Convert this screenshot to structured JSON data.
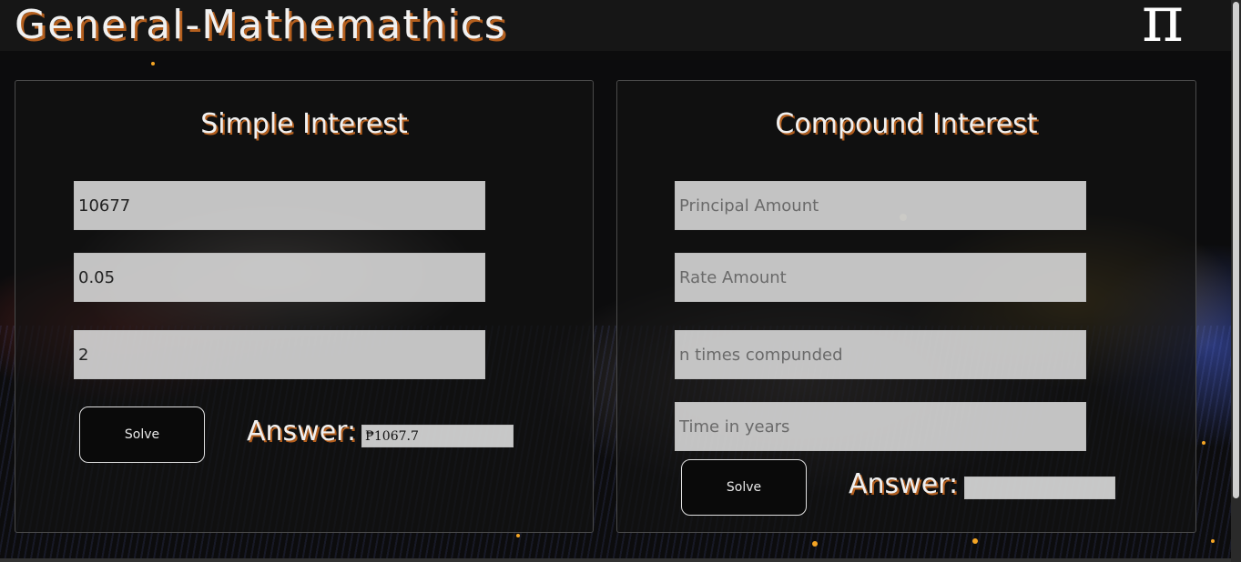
{
  "app": {
    "title": "General-Mathemathics",
    "logo_glyph": "π"
  },
  "simple_interest": {
    "heading": "Simple Interest",
    "principal_value": "10677",
    "rate_value": "0.05",
    "time_value": "2",
    "solve_label": "Solve",
    "answer_label": "Answer:",
    "answer_value": "₱1067.7"
  },
  "compound_interest": {
    "heading": "Compound Interest",
    "principal_placeholder": "Principal Amount",
    "rate_placeholder": "Rate Amount",
    "n_placeholder": "n times compunded",
    "time_placeholder": "Time in years",
    "solve_label": "Solve",
    "answer_label": "Answer:",
    "answer_value": ""
  },
  "colors": {
    "accent_shadow": "#b45f1e",
    "background": "#0c0c0d",
    "spark": "#f5a524"
  },
  "icons": {
    "logo": "pi-icon"
  }
}
